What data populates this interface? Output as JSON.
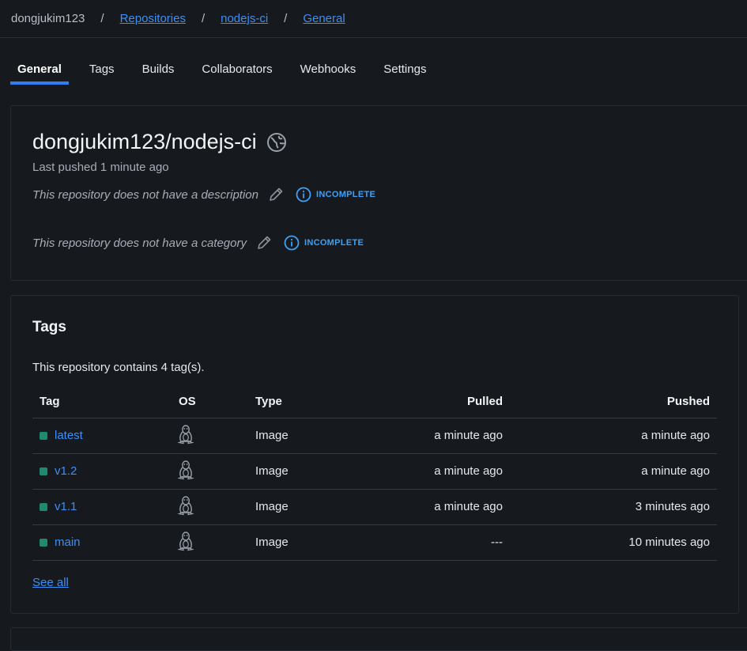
{
  "breadcrumb": {
    "user": "dongjukim123",
    "sep": "/",
    "repositories": "Repositories",
    "repo": "nodejs-ci",
    "current": "General"
  },
  "tabs": [
    "General",
    "Tags",
    "Builds",
    "Collaborators",
    "Webhooks",
    "Settings"
  ],
  "repo": {
    "title": "dongjukim123/nodejs-ci",
    "last_pushed": "Last pushed 1 minute ago",
    "description_text": "This repository does not have a description",
    "description_status": "INCOMPLETE",
    "category_text": "This repository does not have a category",
    "category_status": "INCOMPLETE"
  },
  "tags_section": {
    "title": "Tags",
    "count_text": "This repository contains 4 tag(s).",
    "columns": [
      "Tag",
      "OS",
      "Type",
      "Pulled",
      "Pushed"
    ],
    "rows": [
      {
        "tag": "latest",
        "os": "linux-icon",
        "type": "Image",
        "pulled": "a minute ago",
        "pushed": "a minute ago"
      },
      {
        "tag": "v1.2",
        "os": "linux-icon",
        "type": "Image",
        "pulled": "a minute ago",
        "pushed": "a minute ago"
      },
      {
        "tag": "v1.1",
        "os": "linux-icon",
        "type": "Image",
        "pulled": "a minute ago",
        "pushed": "3 minutes ago"
      },
      {
        "tag": "main",
        "os": "linux-icon",
        "type": "Image",
        "pulled": "---",
        "pushed": "10 minutes ago"
      }
    ],
    "see_all": "See all"
  },
  "colors": {
    "background": "#16191e",
    "link": "#3d8ff5",
    "accent": "#2f7ff0",
    "tag_status": "#1f8a70",
    "incomplete": "#3fa0f5"
  }
}
